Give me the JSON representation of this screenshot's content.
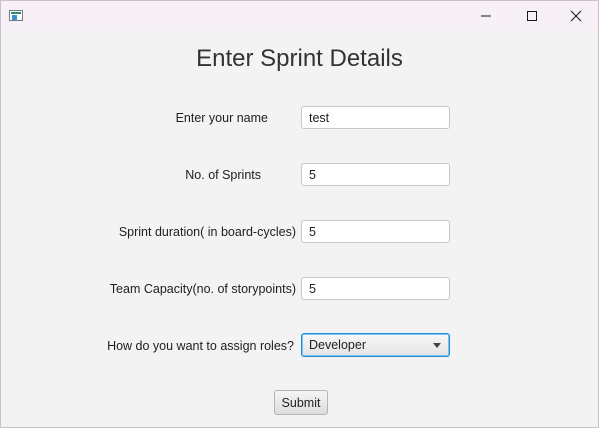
{
  "window": {
    "title_icon": "java-app-icon",
    "controls": [
      "minimize-icon",
      "maximize-icon",
      "close-icon"
    ]
  },
  "form": {
    "title": "Enter Sprint Details",
    "name_label": "Enter your name",
    "name_value": "test",
    "sprints_label": "No. of Sprints",
    "sprints_value": "5",
    "duration_label": "Sprint duration( in board-cycles)",
    "duration_value": "5",
    "capacity_label": "Team Capacity(no. of storypoints)",
    "capacity_value": "5",
    "roles_label": "How do you want to assign roles?",
    "roles_selected": "Developer",
    "submit_label": "Submit"
  },
  "colors": {
    "focus_border": "#1e8fd6",
    "title_bar": "#f7f0f6",
    "background": "#f3f3f3"
  }
}
